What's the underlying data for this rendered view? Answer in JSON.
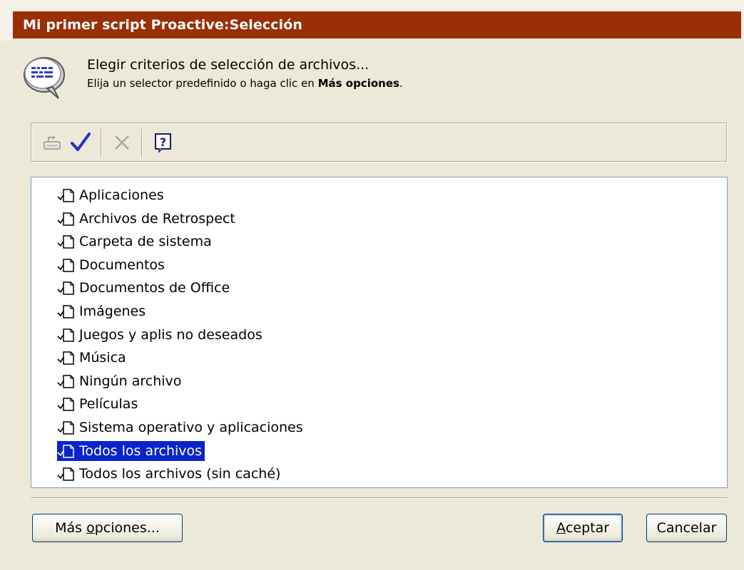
{
  "window": {
    "title": "Mi primer script Proactive:Selección"
  },
  "header": {
    "title": "Elegir criterios de selección de archivos...",
    "subtitle_prefix": "Elija un selector predefinido o haga clic en ",
    "subtitle_bold": "Más opciones",
    "subtitle_suffix": "."
  },
  "toolbar": {
    "buttons": [
      {
        "icon": "edit-icon",
        "enabled": false
      },
      {
        "icon": "check-icon",
        "enabled": true
      },
      {
        "icon": "delete-icon",
        "enabled": false
      },
      {
        "icon": "help-icon",
        "enabled": true
      }
    ]
  },
  "selectors": {
    "items": [
      "Aplicaciones",
      "Archivos de Retrospect",
      "Carpeta de sistema",
      "Documentos",
      "Documentos de Office",
      "Imágenes",
      "Juegos y aplis no deseados",
      "Música",
      "Ningún archivo",
      "Películas",
      "Sistema operativo y aplicaciones",
      "Todos los archivos",
      "Todos los archivos (sin caché)"
    ],
    "selected": "Todos los archivos"
  },
  "buttons": {
    "more_options": {
      "pre": "Más ",
      "mnemonic": "o",
      "post": "pciones..."
    },
    "ok": {
      "pre": "",
      "mnemonic": "A",
      "post": "ceptar"
    },
    "cancel": "Cancelar"
  },
  "colors": {
    "title_bar": "#9a2e05",
    "selection": "#0a24cc",
    "check": "#1e2fc8"
  }
}
